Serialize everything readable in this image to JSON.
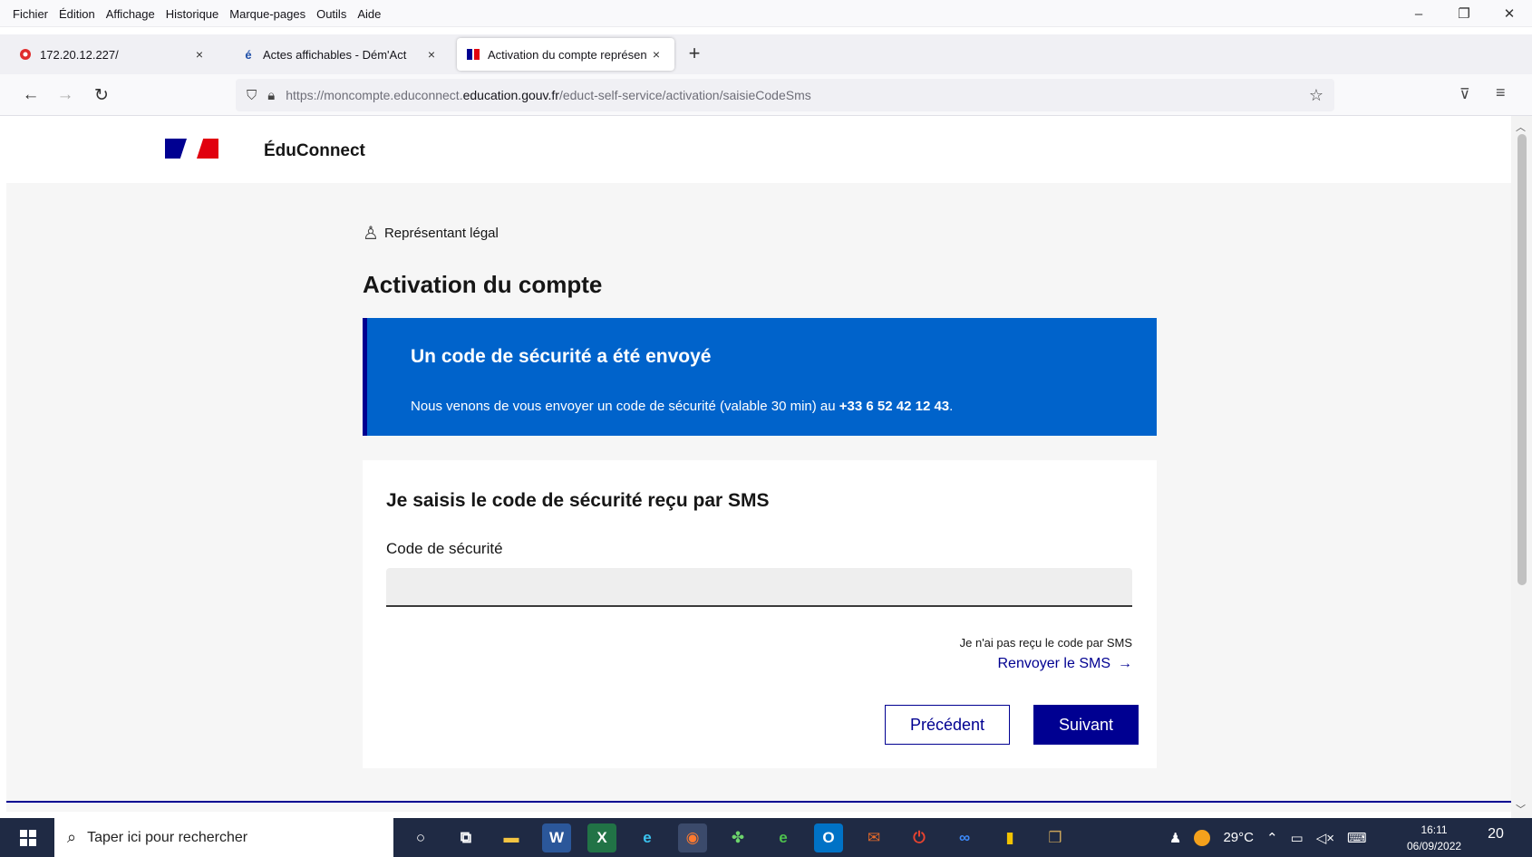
{
  "menu": {
    "items": [
      "Fichier",
      "Édition",
      "Affichage",
      "Historique",
      "Marque-pages",
      "Outils",
      "Aide"
    ]
  },
  "window_controls": {
    "minimize": "–",
    "restore": "❐",
    "close": "✕"
  },
  "tabs": [
    {
      "title": "172.20.12.227/",
      "favicon": "red-app-icon"
    },
    {
      "title": "Actes affichables - Dém'Act",
      "favicon": "e-accent-icon"
    },
    {
      "title": "Activation du compte représent",
      "favicon": "marianne-flag-icon"
    }
  ],
  "tab_close": "×",
  "new_tab": "+",
  "nav": {
    "url_prefix": "https://moncompte.educonnect.",
    "url_domain": "education.gouv.fr",
    "url_path": "/educt-self-service/activation/saisieCodeSms"
  },
  "header": {
    "brand": "ÉduConnect"
  },
  "main": {
    "role": "Représentant légal",
    "title": "Activation du compte",
    "alert": {
      "title": "Un code de sécurité a été envoyé",
      "message_pre": "Nous venons de vous envoyer un code de sécurité (valable 30 min) au ",
      "message_phone": "+33 6 52 42 12 43",
      "message_post": "."
    },
    "form": {
      "heading": "Je saisis le code de sécurité reçu par SMS",
      "code_label": "Code de sécurité",
      "code_value": "",
      "not_received": "Je n'ai pas reçu le code par SMS",
      "resend": "Renvoyer le SMS",
      "prev": "Précédent",
      "next": "Suivant"
    }
  },
  "colors": {
    "dsfr_blue": "#000091",
    "alert_blue": "#0063cb",
    "marianne_red": "#e1000f"
  },
  "taskbar": {
    "search_placeholder": "Taper ici pour rechercher",
    "weather": "29°C",
    "time": "16:11",
    "date": "06/09/2022",
    "notifications": "20"
  }
}
